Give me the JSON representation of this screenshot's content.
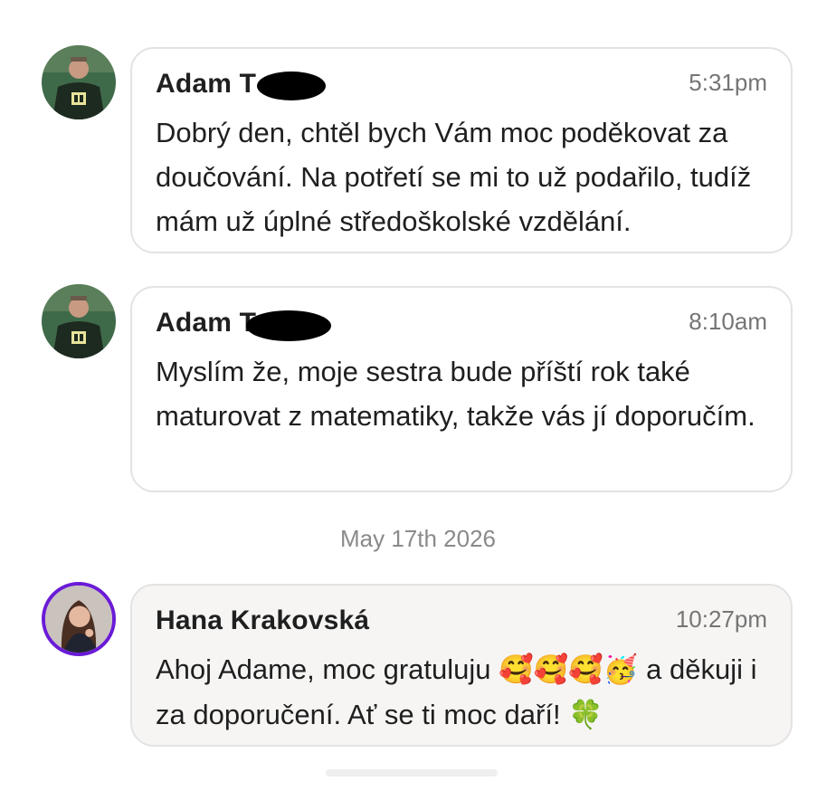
{
  "messages": [
    {
      "sender": "Adam T",
      "time": "5:31pm",
      "text": "Dobrý den, chtěl bych Vám moc poděkovat za doučování. Na potřetí se mi to už podařilo, tudíž mám už úplné středoškolské vzdělání."
    },
    {
      "sender": "Adam T",
      "time": "8:10am",
      "text": "Myslím že, moje sestra bude příští rok také maturovat z matematiky, takže vás jí doporučím."
    },
    {
      "sender": "Hana Krakovská",
      "time": "10:27pm",
      "text_before_emoji": "Ahoj Adame, moc gratuluju ",
      "emoji": "🥰🥰🥰🥳",
      "text_after_emoji": " a děkuji i za doporučení. Ať se ti moc daří! ",
      "end_emoji": "🍀"
    }
  ],
  "date_separator": "May 17th 2026",
  "colors": {
    "bubble_border": "#e3e3e3",
    "highlight_bubble_bg": "#f6f5f4",
    "avatar_ring": "#6a1bd6"
  }
}
